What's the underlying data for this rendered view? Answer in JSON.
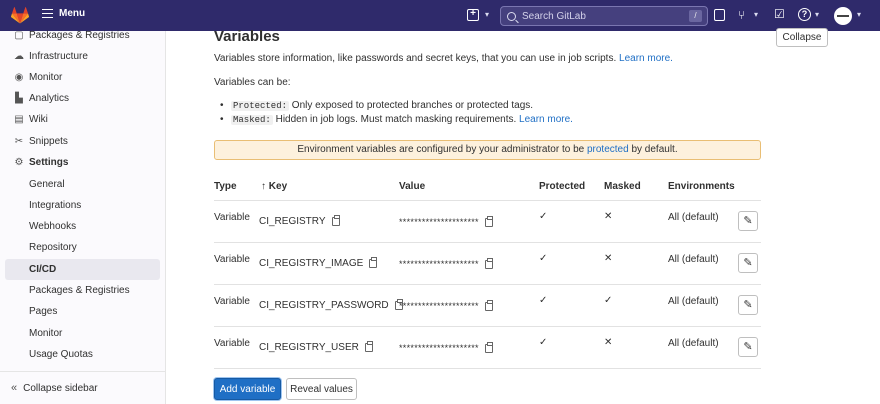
{
  "topbar": {
    "menu_label": "Menu",
    "search_placeholder": "Search GitLab",
    "search_shortcut": "/"
  },
  "sidebar": {
    "items": [
      {
        "label": "Packages & Registries",
        "icon": "package-icon"
      },
      {
        "label": "Infrastructure",
        "icon": "cloud-icon"
      },
      {
        "label": "Monitor",
        "icon": "monitor-icon"
      },
      {
        "label": "Analytics",
        "icon": "chart-icon"
      },
      {
        "label": "Wiki",
        "icon": "book-icon"
      },
      {
        "label": "Snippets",
        "icon": "snippet-icon"
      },
      {
        "label": "Settings",
        "icon": "gear-icon"
      }
    ],
    "sub_items": [
      {
        "label": "General"
      },
      {
        "label": "Integrations"
      },
      {
        "label": "Webhooks"
      },
      {
        "label": "Repository"
      },
      {
        "label": "CI/CD"
      },
      {
        "label": "Packages & Registries"
      },
      {
        "label": "Pages"
      },
      {
        "label": "Monitor"
      },
      {
        "label": "Usage Quotas"
      }
    ],
    "collapse_label": "Collapse sidebar"
  },
  "main": {
    "title": "Variables",
    "collapse_label": "Collapse",
    "description": "Variables store information, like passwords and secret keys, that you can use in job scripts.",
    "learn_more": "Learn more.",
    "can_be": "Variables can be:",
    "bullets": [
      {
        "code": "Protected:",
        "text": "Only exposed to protected branches or protected tags.",
        "link": ""
      },
      {
        "code": "Masked:",
        "text": "Hidden in job logs. Must match masking requirements.",
        "link": "Learn more."
      }
    ],
    "alert": {
      "before": "Environment variables are configured by your administrator to be",
      "link": "protected",
      "after": "by default."
    },
    "columns": {
      "type": "Type",
      "key": "Key",
      "value": "Value",
      "protected": "Protected",
      "masked": "Masked",
      "environments": "Environments"
    },
    "rows": [
      {
        "type": "Variable",
        "key": "CI_REGISTRY",
        "value": "*********************",
        "protected": "✓",
        "masked": "✕",
        "environments": "All (default)"
      },
      {
        "type": "Variable",
        "key": "CI_REGISTRY_IMAGE",
        "value": "*********************",
        "protected": "✓",
        "masked": "✕",
        "environments": "All (default)"
      },
      {
        "type": "Variable",
        "key": "CI_REGISTRY_PASSWORD",
        "value": "*********************",
        "protected": "✓",
        "masked": "✓",
        "environments": "All (default)"
      },
      {
        "type": "Variable",
        "key": "CI_REGISTRY_USER",
        "value": "*********************",
        "protected": "✓",
        "masked": "✕",
        "environments": "All (default)"
      }
    ],
    "add_label": "Add variable",
    "reveal_label": "Reveal values"
  },
  "colors": {
    "topbar": "#2f2a6b",
    "link": "#1f6fc5",
    "primary": "#1f6fc5",
    "alert_bg": "#fdf1dd"
  }
}
